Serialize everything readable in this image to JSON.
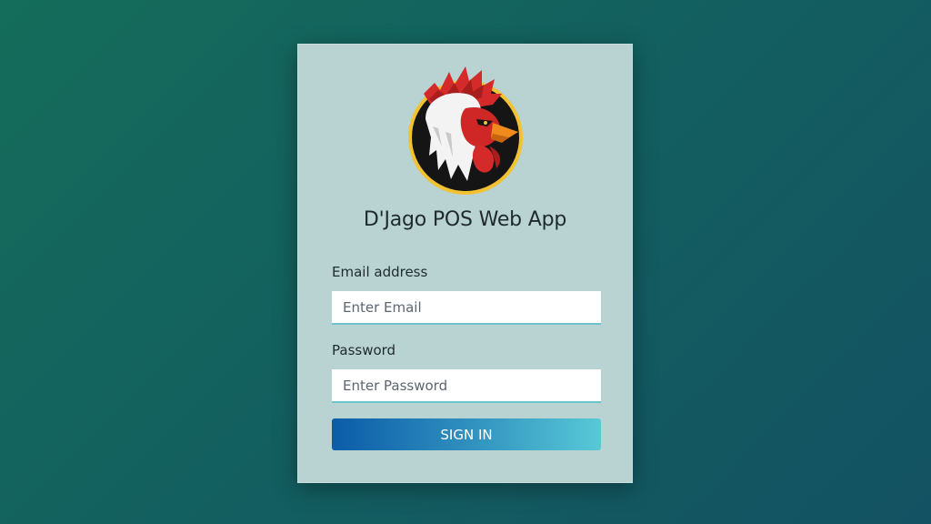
{
  "app": {
    "title": "D'Jago POS Web App",
    "logo_icon": "rooster-logo-icon"
  },
  "form": {
    "email_label": "Email address",
    "email_placeholder": "Enter Email",
    "email_value": "",
    "password_label": "Password",
    "password_placeholder": "Enter Password",
    "password_value": "",
    "submit_label": "SIGN IN"
  },
  "colors": {
    "background_start": "#146c5a",
    "background_end": "#135262",
    "card": "#b9d2d2",
    "button_start": "#0b5ca8",
    "button_end": "#58c9d6",
    "logo_ring": "#f2c230"
  }
}
